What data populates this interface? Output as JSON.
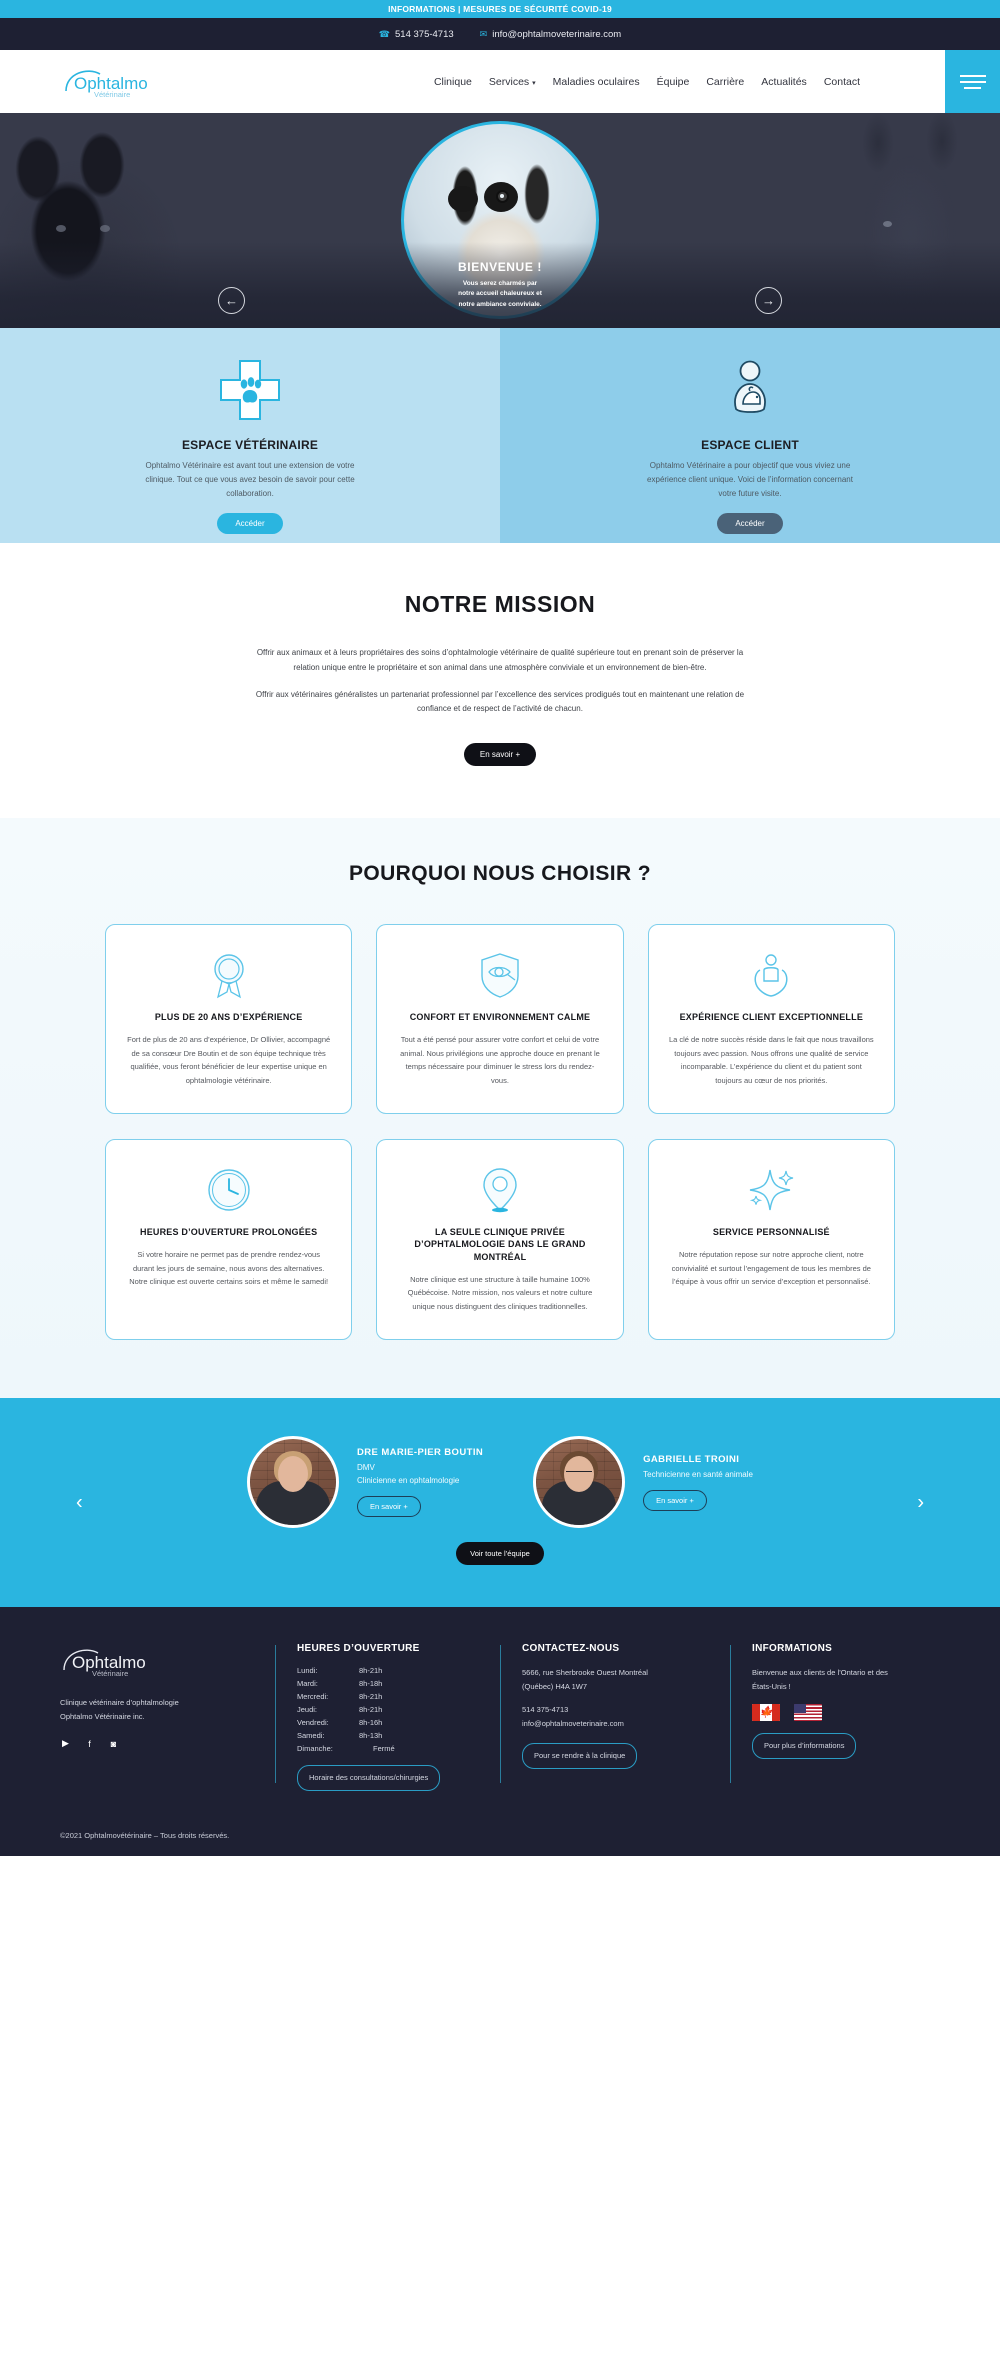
{
  "topbanner": {
    "text": "INFORMATIONS | MESURES DE SÉCURITÉ COVID-19"
  },
  "contactbar": {
    "phone": "514 375-4713",
    "email": "info@ophtalmoveterinaire.com",
    "phone_icon": "phone-icon",
    "email_icon": "envelope-icon"
  },
  "header": {
    "logo_main": "Ophtalmo",
    "logo_sub": "Vétérinaire",
    "nav": [
      {
        "label": "Clinique",
        "caret": false
      },
      {
        "label": "Services",
        "caret": true
      },
      {
        "label": "Maladies oculaires",
        "caret": false
      },
      {
        "label": "Équipe",
        "caret": false
      },
      {
        "label": "Carrière",
        "caret": false
      },
      {
        "label": "Actualités",
        "caret": false
      },
      {
        "label": "Contact",
        "caret": false
      }
    ],
    "caret_glyph": "▾",
    "menu_icon": "hamburger-menu-icon"
  },
  "hero": {
    "title": "BIENVENUE !",
    "line1": "Vous serez charmés par",
    "line2": "notre accueil chaleureux et",
    "line3": "notre ambiance conviviale.",
    "prev_glyph": "←",
    "next_glyph": "→"
  },
  "dual": {
    "left": {
      "icon": "veterinary-cross-paw-icon",
      "title": "ESPACE VÉTÉRINAIRE",
      "body": "Ophtalmo Vétérinaire est avant tout une extension de votre clinique. Tout ce que vous avez besoin de savoir pour cette collaboration.",
      "button": "Accéder"
    },
    "right": {
      "icon": "person-holding-dog-icon",
      "title": "ESPACE CLIENT",
      "body": "Ophtalmo Vétérinaire a pour objectif que vous viviez une expérience client unique. Voici de l’information concernant votre future visite.",
      "button": "Accéder"
    }
  },
  "mission": {
    "title": "NOTRE MISSION",
    "p1": "Offrir aux animaux et à leurs propriétaires des soins d’ophtalmologie vétérinaire de qualité supérieure tout en prenant soin de préserver la relation unique entre le propriétaire et son animal dans une atmosphère conviviale et un environnement de bien-être.",
    "p2": "Offrir aux vétérinaires généralistes un partenariat professionnel par l’excellence des services prodigués tout en maintenant une relation de confiance et de respect de l’activité de chacun.",
    "button": "En savoir +"
  },
  "why": {
    "title": "POURQUOI NOUS CHOISIR ?",
    "cards": [
      {
        "icon": "award-ribbon-icon",
        "title": "PLUS DE 20 ANS D’EXPÉRIENCE",
        "body": "Fort de plus de 20 ans d’expérience, Dr Ollivier, accompagné de sa consœur Dre Boutin et de son équipe technique très qualifiée, vous feront bénéficier de leur expertise unique en ophtalmologie vétérinaire."
      },
      {
        "icon": "shield-eye-icon",
        "title": "CONFORT ET ENVIRONNEMENT CALME",
        "body": "Tout a été pensé pour assurer votre confort et celui de votre animal. Nous privilégions une approche douce en prenant le temps nécessaire pour diminuer le stress lors du rendez-vous."
      },
      {
        "icon": "hands-person-icon",
        "title": "EXPÉRIENCE CLIENT EXCEPTIONNELLE",
        "body": "La clé de notre succès réside dans le fait que nous travaillons toujours avec passion. Nous offrons une qualité de service incomparable. L’expérience du client et du patient sont toujours au cœur de nos priorités."
      },
      {
        "icon": "clock-icon",
        "title": "HEURES D’OUVERTURE PROLONGÉES",
        "body": "Si votre horaire ne permet pas de prendre rendez-vous durant les jours de semaine, nous avons des alternatives. Notre clinique est ouverte certains soirs et même le samedi!"
      },
      {
        "icon": "map-pin-icon",
        "title": "LA SEULE CLINIQUE PRIVÉE D’OPHTALMOLOGIE DANS LE GRAND MONTRÉAL",
        "body": "Notre clinique est une structure à taille humaine 100% Québécoise. Notre mission, nos valeurs et notre culture unique nous distinguent des cliniques traditionnelles."
      },
      {
        "icon": "sparkle-icon",
        "title": "SERVICE PERSONNALISÉ",
        "body": "Notre réputation repose sur notre approche client, notre convivialité et surtout l’engagement de tous les membres de l’équipe à vous offrir un service d’exception et personnalisé."
      }
    ]
  },
  "team": {
    "prev_glyph": "‹",
    "next_glyph": "›",
    "members": [
      {
        "name": "DRE MARIE-PIER BOUTIN",
        "credential": "DMV",
        "role": "Clinicienne en ophtalmologie",
        "button": "En savoir +"
      },
      {
        "name": "GABRIELLE TROINI",
        "credential": "",
        "role": "Technicienne en santé animale",
        "button": "En savoir +"
      }
    ],
    "all_team_button": "Voir toute l’équipe"
  },
  "footer": {
    "logo_main": "Ophtalmo",
    "logo_sub": "Vétérinaire",
    "desc_line1": "Clinique vétérinaire d’ophtalmologie",
    "desc_line2": "Ophtalmo Vétérinaire inc.",
    "social": [
      {
        "icon": "youtube-icon",
        "glyph": "▶"
      },
      {
        "icon": "facebook-icon",
        "glyph": "f"
      },
      {
        "icon": "instagram-icon",
        "glyph": "◙"
      }
    ],
    "hours": {
      "title": "HEURES D’OUVERTURE",
      "rows": [
        {
          "day": "Lundi:",
          "value": "8h-21h"
        },
        {
          "day": "Mardi:",
          "value": "8h-18h"
        },
        {
          "day": "Mercredi:",
          "value": "8h-21h"
        },
        {
          "day": "Jeudi:",
          "value": "8h-21h"
        },
        {
          "day": "Vendredi:",
          "value": "8h-16h"
        },
        {
          "day": "Samedi:",
          "value": "8h-13h"
        },
        {
          "day": "Dimanche:",
          "value": "Fermé"
        }
      ],
      "button": "Horaire des consultations/chirurgies"
    },
    "contact": {
      "title": "CONTACTEZ-NOUS",
      "address1": "5666, rue Sherbrooke Ouest Montréal",
      "address2": "(Québec) H4A 1W7",
      "phone": "514 375-4713",
      "email": "info@ophtalmoveterinaire.com",
      "button": "Pour se rendre à la clinique"
    },
    "informations": {
      "title": "INFORMATIONS",
      "text1": "Bienvenue aux clients de l’Ontario et des",
      "text2": "États-Unis !",
      "flag_ca": "canada-flag-icon",
      "flag_us": "usa-flag-icon",
      "button": "Pour plus d’informations"
    },
    "copyright": "©2021 Ophtalmovétérinaire – Tous droits réservés."
  },
  "colors": {
    "accent": "#2ab5e0",
    "dark": "#1e2033",
    "light_blue": "#b9e0f2",
    "mid_blue": "#8ecdea"
  }
}
